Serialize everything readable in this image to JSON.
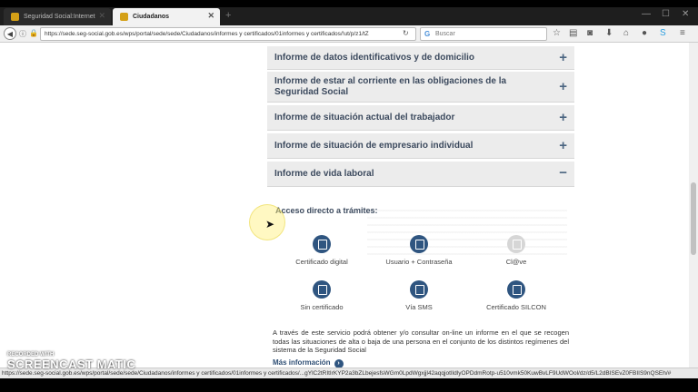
{
  "browser": {
    "tabs": [
      {
        "title": "Seguridad Social:Internet",
        "active": false
      },
      {
        "title": "Ciudadanos",
        "active": true
      }
    ],
    "url": "https://sede.seg-social.gob.es/wps/portal/sede/sede/Ciudadanos/informes y certificados/01informes y certificados/!ut/p/z1/tZ",
    "search_placeholder": "Buscar",
    "status_url": "https://sede.seg-social.gob.es/wps/portal/sede/sede/Ciudadanos/informes y certificados/01informes y certificados/...gYlC2tRItIrKYP2a3bZLbejesfsWGm0LpdWgxjjl42aqqjotIldlyOPDdmRotp-u510vmk50KuwBvLF9UdWOol/dz/d5/L2dBISEvZ0FBIIS9nQSEh/#"
  },
  "accordion": [
    {
      "label": "Informe de datos identificativos y de domicilio",
      "sign": "+"
    },
    {
      "label": "Informe de estar al corriente en las obligaciones de la Seguridad Social",
      "sign": "+"
    },
    {
      "label": "Informe de situación actual del trabajador",
      "sign": "+"
    },
    {
      "label": "Informe de situación de empresario individual",
      "sign": "+"
    },
    {
      "label": "Informe de vida laboral",
      "sign": "−"
    }
  ],
  "section": {
    "title": "Acceso directo a trámites:",
    "tiles": [
      {
        "label": "Certificado digital",
        "icon": "certificate-icon"
      },
      {
        "label": "Usuario + Contraseña",
        "icon": "user-lock-icon"
      },
      {
        "label": "Cl@ve",
        "icon": "clave-icon"
      },
      {
        "label": "Sin certificado",
        "icon": "no-certificate-icon"
      },
      {
        "label": "Vía SMS",
        "icon": "mobile-icon"
      },
      {
        "label": "Certificado SILCON",
        "icon": "silcon-icon"
      }
    ],
    "description": "A través de este servicio podrá obtener y/o consultar on-line un informe en el que se recogen todas las situaciones de alta o baja de una persona en el conjunto de los distintos regímenes del sistema de la Seguridad Social",
    "more_info": "Más información"
  },
  "watermark": {
    "recorded": "RECORDED WITH",
    "brand": "SCREENCAST MATIC"
  },
  "colors": {
    "accent": "#2f5580",
    "header_text": "#3c4a5e",
    "accordion_bg": "#ececec"
  }
}
